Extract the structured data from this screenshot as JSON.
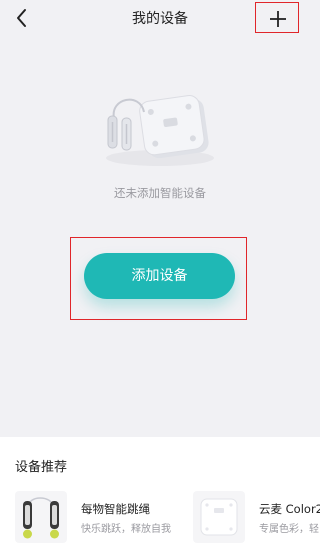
{
  "header": {
    "title": "我的设备",
    "back_icon": "chevron-left-icon",
    "add_icon": "plus-icon"
  },
  "empty_state": {
    "illustration": "scale-and-jump-rope-illustration",
    "message": "还未添加智能设备"
  },
  "primary_action": {
    "label": "添加设备",
    "color": "#1fb8b5"
  },
  "recommend": {
    "title": "设备推荐",
    "items": [
      {
        "name": "每物智能跳绳",
        "desc": "快乐跳跃，释放自我",
        "image": "jump-rope-image"
      },
      {
        "name": "云麦 Color2",
        "desc": "专属色彩，轻",
        "image": "smart-scale-image"
      }
    ]
  },
  "colors": {
    "background": "#f1f1f4",
    "highlight_border": "#e0262a",
    "accent": "#1fb8b5"
  }
}
